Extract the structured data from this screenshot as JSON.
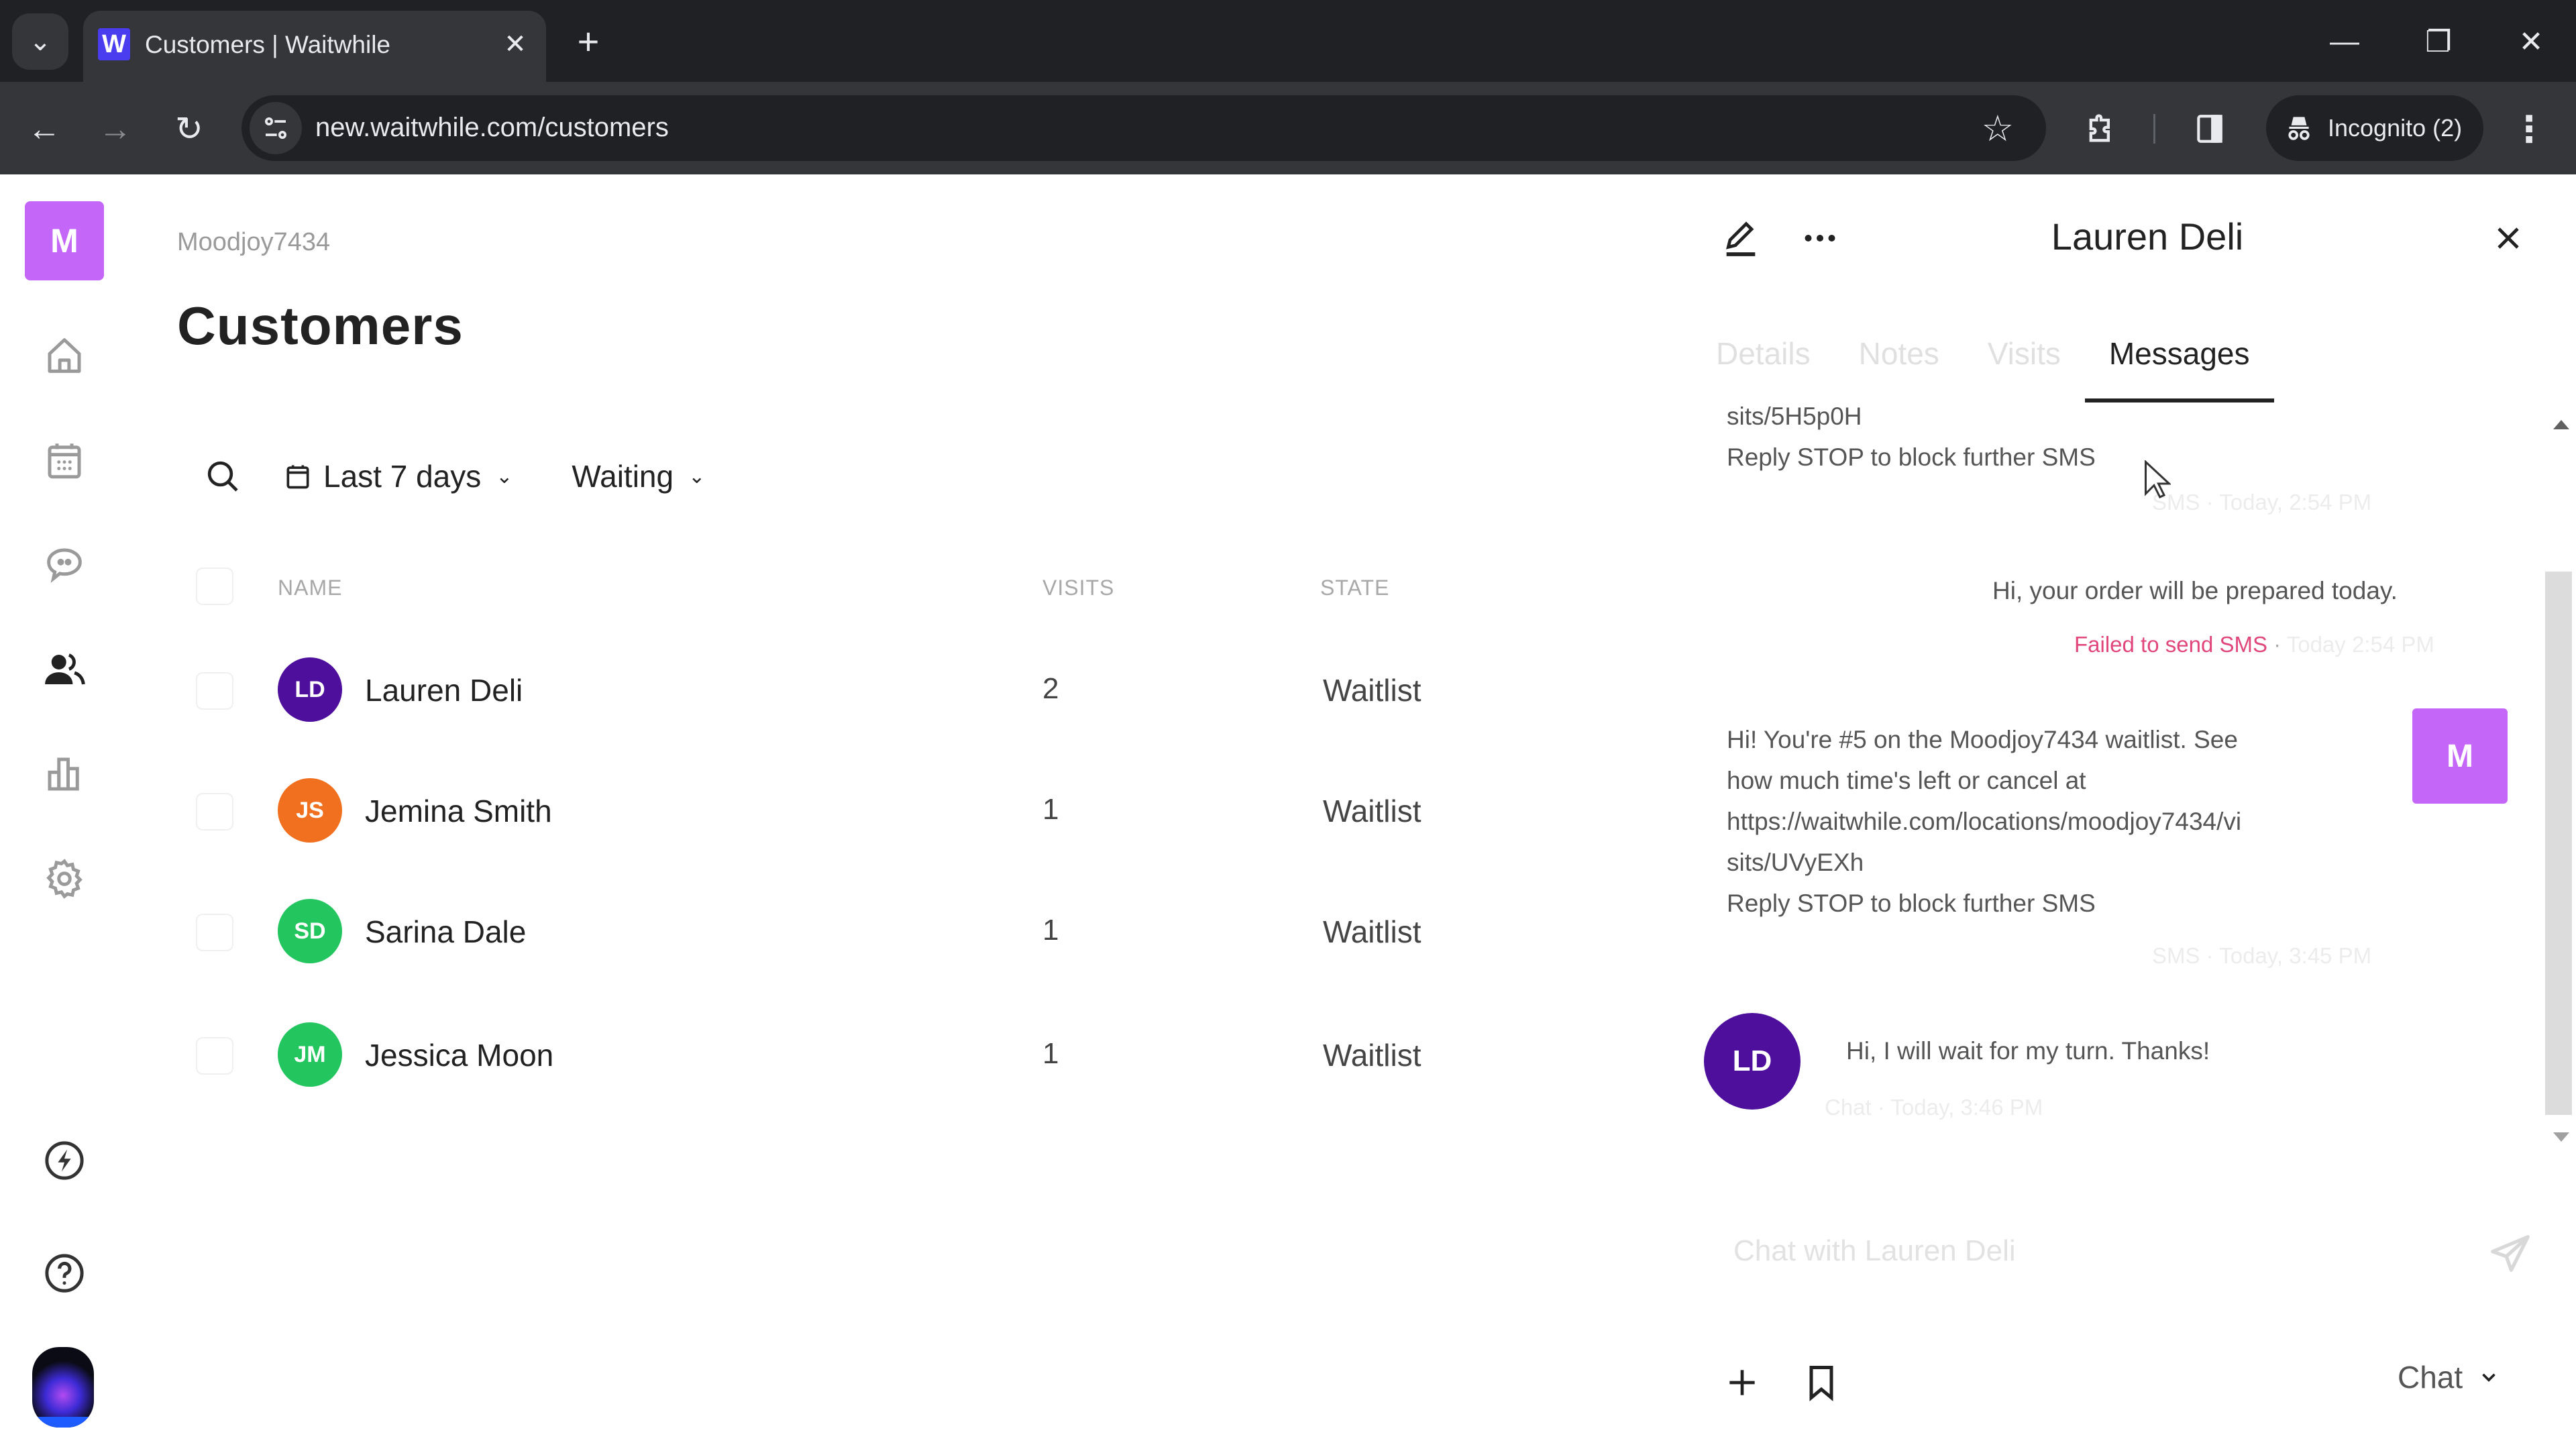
{
  "browser": {
    "tab_title": "Customers | Waitwhile",
    "favicon_letter": "W",
    "url": "new.waitwhile.com/customers",
    "incognito_label": "Incognito (2)",
    "icons": {
      "tab_list": "chevron-down-icon",
      "close_tab": "close-icon",
      "new_tab": "plus-icon",
      "minimize": "minimize-icon",
      "restore": "restore-icon",
      "close_window": "close-icon",
      "back": "arrow-left-icon",
      "forward": "arrow-right-icon",
      "reload": "reload-icon",
      "site_info": "tune-icon",
      "bookmark": "star-icon",
      "extensions": "puzzle-icon",
      "side_panel": "side-panel-icon",
      "incognito": "incognito-icon",
      "menu": "kebab-icon"
    },
    "glyphs": {
      "tab_list": "⌄",
      "close": "✕",
      "new_tab": "+",
      "minimize": "—",
      "restore": "❐",
      "back": "←",
      "forward": "→",
      "reload": "↻",
      "site_info": "⚙",
      "star": "☆",
      "extensions": "⧉",
      "side_panel": "▯",
      "incognito": "🕶",
      "menu": "⋮"
    }
  },
  "sidebar": {
    "logo_letter": "M",
    "items": [
      {
        "name": "home",
        "icon": "home-icon",
        "active": false
      },
      {
        "name": "calendar",
        "icon": "calendar-icon",
        "active": false
      },
      {
        "name": "messages",
        "icon": "chat-bubble-icon",
        "active": false
      },
      {
        "name": "customers",
        "icon": "users-icon",
        "active": true
      },
      {
        "name": "analytics",
        "icon": "bar-chart-icon",
        "active": false
      },
      {
        "name": "settings",
        "icon": "gear-icon",
        "active": false
      }
    ],
    "bottom_items": [
      {
        "name": "whats-new",
        "icon": "lightning-icon"
      },
      {
        "name": "help",
        "icon": "help-icon"
      },
      {
        "name": "profile",
        "icon": "avatar"
      }
    ]
  },
  "main": {
    "org_name": "Moodjoy7434",
    "title": "Customers",
    "filters": {
      "search_icon": "search-icon",
      "date_range": "Last 7 days",
      "status": "Waiting"
    },
    "table": {
      "columns": [
        "NAME",
        "VISITS",
        "STATE"
      ],
      "rows": [
        {
          "initials": "LD",
          "name": "Lauren Deli",
          "visits": "2",
          "state": "Waitlist",
          "color": "#4d0f9c"
        },
        {
          "initials": "JS",
          "name": "Jemina Smith",
          "visits": "1",
          "state": "Waitlist",
          "color": "#f07020"
        },
        {
          "initials": "SD",
          "name": "Sarina Dale",
          "visits": "1",
          "state": "Waitlist",
          "color": "#22c55e"
        },
        {
          "initials": "JM",
          "name": "Jessica Moon",
          "visits": "1",
          "state": "Waitlist",
          "color": "#22c55e"
        }
      ]
    }
  },
  "panel": {
    "title": "Lauren Deli",
    "tabs": [
      {
        "label": "Details",
        "active": false
      },
      {
        "label": "Notes",
        "active": false
      },
      {
        "label": "Visits",
        "active": false
      },
      {
        "label": "Messages",
        "active": true
      }
    ],
    "messages": [
      {
        "from": "business",
        "text": "sits/5H5p0H\nReply STOP to block further SMS",
        "meta": "SMS · Today, 2:54 PM"
      },
      {
        "from": "business",
        "text": "Hi, your order will be prepared today.",
        "status": "Failed to send SMS",
        "meta": "Today 2:54 PM"
      },
      {
        "from": "business",
        "avatar": "M",
        "text": "Hi! You're #5 on the Moodjoy7434 waitlist. See\nhow much time's left or cancel at\nhttps://waitwhile.com/locations/moodjoy7434/vi\nsits/UVyEXh\nReply STOP to block further SMS",
        "meta": "SMS · Today, 3:45 PM"
      },
      {
        "from": "customer",
        "avatar": "LD",
        "text": "Hi, I will wait for my turn. Thanks!",
        "meta": "Chat · Today, 3:46 PM"
      }
    ],
    "composer": {
      "placeholder": "Chat with Lauren Deli",
      "value": "",
      "channel": "Chat"
    },
    "colors": {
      "brand": "#c466f7",
      "failed": "#e0457b",
      "customer_avatar": "#4d0f9c"
    }
  }
}
